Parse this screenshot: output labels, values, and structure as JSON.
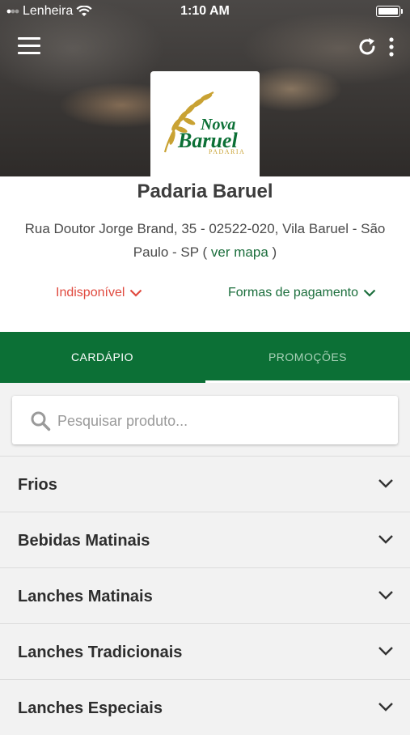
{
  "status_bar": {
    "carrier": "Lenheira",
    "time": "1:10 AM"
  },
  "store": {
    "logo_text_1": "Nova",
    "logo_text_2": "Baruel",
    "logo_text_3": "PADARIA",
    "name": "Padaria Baruel",
    "address": "Rua Doutor Jorge Brand, 35 - 02522-020, Vila Baruel - São Paulo - SP",
    "map_link_open": "(",
    "map_link": "ver mapa",
    "map_link_close": ")",
    "status_label": "Indisponível",
    "payment_label": "Formas de pagamento"
  },
  "tabs": [
    {
      "label": "CARDÁPIO"
    },
    {
      "label": "PROMOÇÕES"
    }
  ],
  "search": {
    "placeholder": "Pesquisar produto..."
  },
  "categories": [
    {
      "label": "Frios"
    },
    {
      "label": "Bebidas Matinais"
    },
    {
      "label": "Lanches Matinais"
    },
    {
      "label": "Lanches Tradicionais"
    },
    {
      "label": "Lanches Especiais"
    }
  ],
  "colors": {
    "primary_green": "#0c7036",
    "unavailable_red": "#e04a3f",
    "logo_gold": "#c9a233"
  },
  "icons": [
    "menu-icon",
    "refresh-icon",
    "kebab-icon",
    "wifi-icon",
    "battery-icon",
    "search-icon",
    "chevron-down-icon"
  ]
}
